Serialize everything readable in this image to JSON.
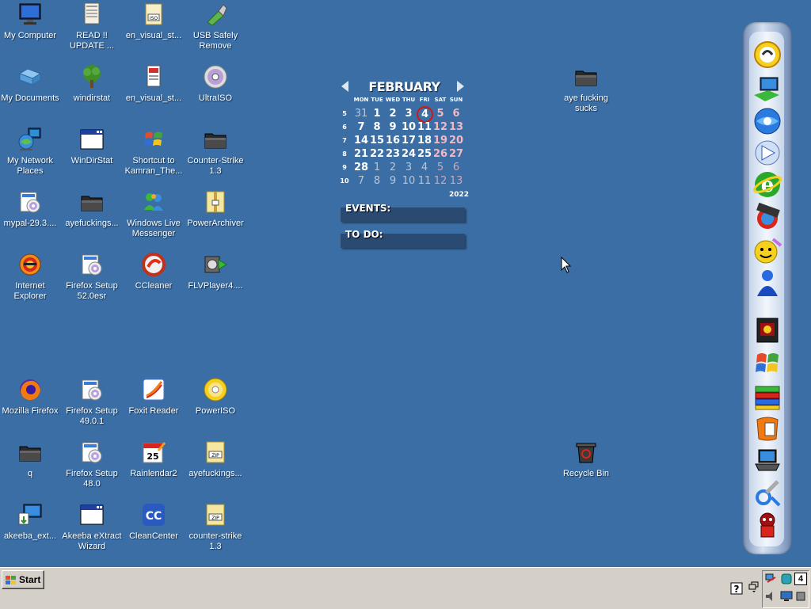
{
  "desktop": {
    "icons": [
      {
        "label": "My Computer",
        "icon": "monitor-icon"
      },
      {
        "label": "READ !!\nUPDATE ...",
        "icon": "text-file-icon"
      },
      {
        "label": "en_visual_st...",
        "icon": "iso-file-icon"
      },
      {
        "label": "USB Safely\nRemove",
        "icon": "usb-remove-icon"
      },
      {
        "label": "My Documents",
        "icon": "folder-documents-icon"
      },
      {
        "label": "windirstat",
        "icon": "tree-icon"
      },
      {
        "label": "en_visual_st...",
        "icon": "document-icon"
      },
      {
        "label": "UltraISO",
        "icon": "disc-icon"
      },
      {
        "label": "My Network\nPlaces",
        "icon": "network-globe-icon"
      },
      {
        "label": "WinDirStat",
        "icon": "window-icon"
      },
      {
        "label": "Shortcut to\nKamran_The...",
        "icon": "windows-logo-icon"
      },
      {
        "label": "Counter-Strike\n1.3",
        "icon": "dark-folder-icon"
      },
      {
        "label": "mypal-29.3....",
        "icon": "installer-icon"
      },
      {
        "label": "ayefuckings...",
        "icon": "dark-folder-icon"
      },
      {
        "label": "Windows Live\nMessenger",
        "icon": "messenger-icon"
      },
      {
        "label": "PowerArchiver",
        "icon": "archive-icon"
      },
      {
        "label": "Internet\nExplorer",
        "icon": "ie-icon"
      },
      {
        "label": "Firefox Setup\n52.0esr",
        "icon": "installer-icon"
      },
      {
        "label": "CCleaner",
        "icon": "ccleaner-icon"
      },
      {
        "label": "FLVPlayer4....",
        "icon": "film-icon"
      },
      {
        "label": "Mozilla Firefox",
        "icon": "firefox-icon"
      },
      {
        "label": "Firefox Setup\n49.0.1",
        "icon": "installer-icon"
      },
      {
        "label": "Foxit Reader",
        "icon": "foxit-icon"
      },
      {
        "label": "PowerISO",
        "icon": "gold-disc-icon"
      },
      {
        "label": "q",
        "icon": "dark-folder-icon"
      },
      {
        "label": "Firefox Setup\n48.0",
        "icon": "installer-icon"
      },
      {
        "label": "Rainlendar2",
        "icon": "calendar-icon"
      },
      {
        "label": "ayefuckings...",
        "icon": "zip-icon"
      },
      {
        "label": "akeeba_ext...",
        "icon": "installer-computer-icon"
      },
      {
        "label": "Akeeba eXtract\nWizard",
        "icon": "window-icon"
      },
      {
        "label": "CleanCenter",
        "icon": "cc-icon"
      },
      {
        "label": "counter-strike\n1.3",
        "icon": "zip-icon"
      },
      {
        "label": "aye fucking\nsucks",
        "icon": "dark-folder-icon"
      },
      {
        "label": "Recycle Bin",
        "icon": "recycle-bin-icon"
      }
    ]
  },
  "calendar": {
    "month": "FEBRUARY",
    "year": "2022",
    "weekdays": [
      "MON",
      "TUE",
      "WED",
      "THU",
      "FRI",
      "SAT",
      "SUN"
    ],
    "weeks": [
      {
        "num": "5",
        "days": [
          "31",
          "1",
          "2",
          "3",
          "4",
          "5",
          "6"
        ]
      },
      {
        "num": "6",
        "days": [
          "7",
          "8",
          "9",
          "10",
          "11",
          "12",
          "13"
        ]
      },
      {
        "num": "7",
        "days": [
          "14",
          "15",
          "16",
          "17",
          "18",
          "19",
          "20"
        ]
      },
      {
        "num": "8",
        "days": [
          "21",
          "22",
          "23",
          "24",
          "25",
          "26",
          "27"
        ]
      },
      {
        "num": "9",
        "days": [
          "28",
          "1",
          "2",
          "3",
          "4",
          "5",
          "6"
        ]
      },
      {
        "num": "10",
        "days": [
          "7",
          "8",
          "9",
          "10",
          "11",
          "12",
          "13"
        ]
      }
    ],
    "today": "4",
    "events_label": "EVENTS:",
    "todo_label": "TO DO:"
  },
  "dock": {
    "items": [
      "rocketdock-icon",
      "computer-icon",
      "ie-globe-icon",
      "media-icon",
      "ie-e-icon",
      "media-player-icon",
      "smiley-icon",
      "messenger-person-icon",
      "game-icon",
      "windows-flag-icon",
      "books-icon",
      "office-icon",
      "laptop-icon",
      "tools-icon",
      "character-icon"
    ]
  },
  "taskbar": {
    "start_label": "Start",
    "tray_count": "4"
  },
  "colors": {
    "desktop": "#3a6ea5",
    "taskbar": "#d4d0c8"
  }
}
